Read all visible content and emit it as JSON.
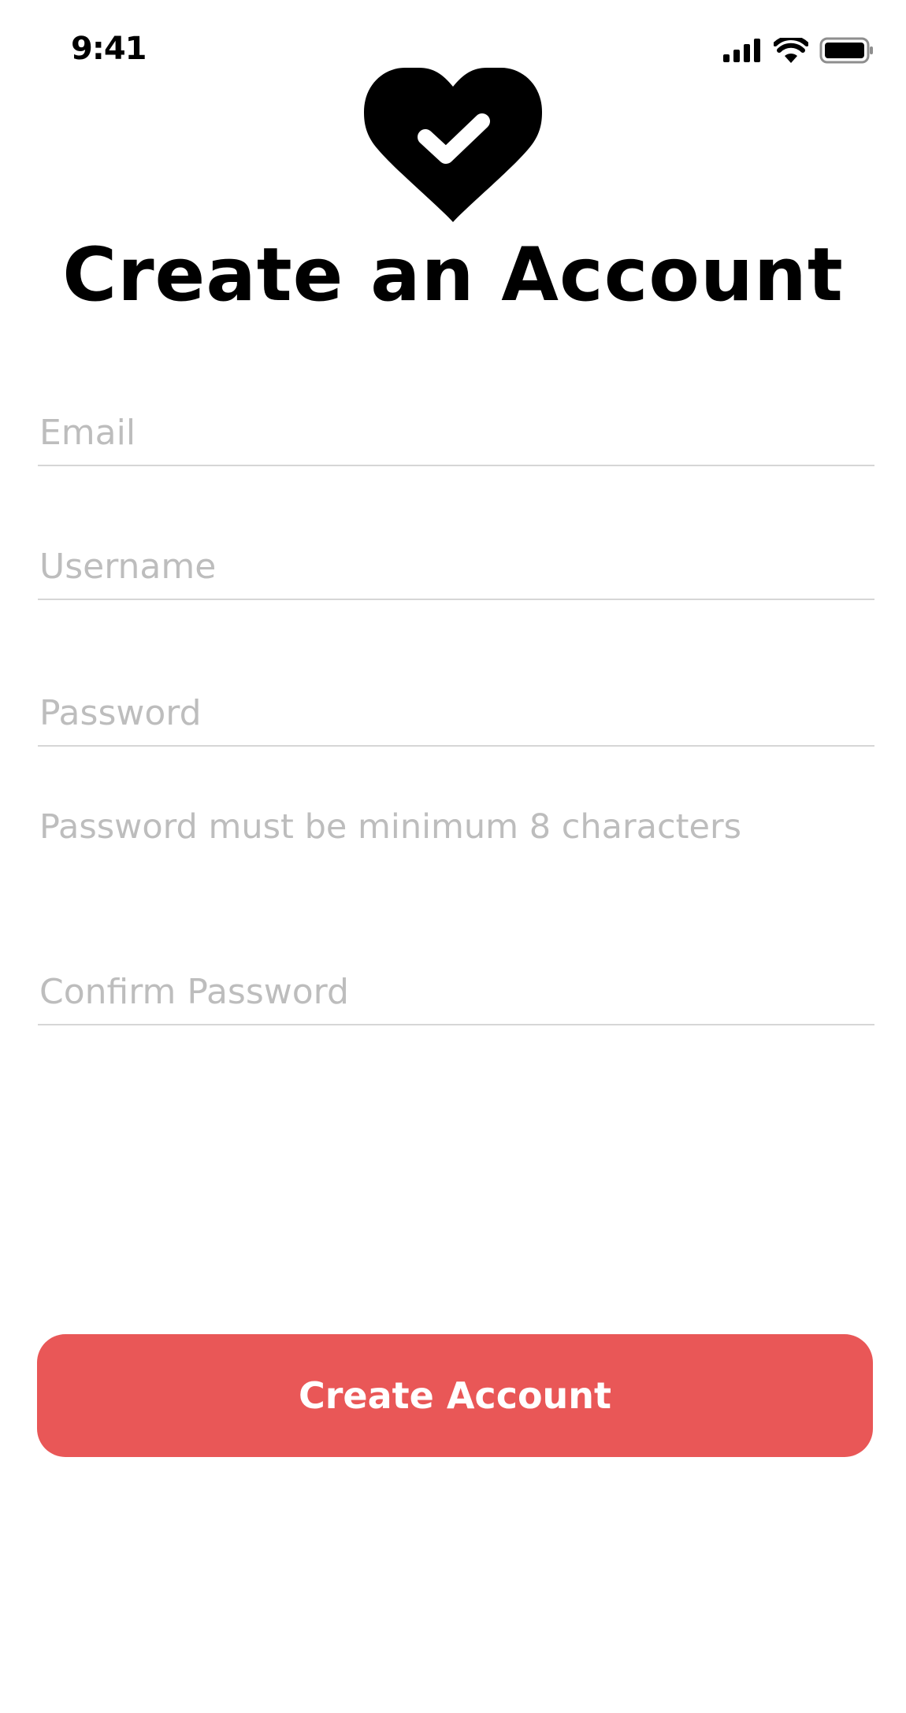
{
  "status_bar": {
    "time": "9:41",
    "icons": [
      "cellular-signal-icon",
      "wifi-icon",
      "battery-icon"
    ]
  },
  "logo": {
    "icon": "heart-check-icon"
  },
  "title": "Create an Account",
  "form": {
    "email_placeholder": "Email",
    "email_value": "",
    "username_placeholder": "Username",
    "username_value": "",
    "password_placeholder": "Password",
    "password_value": "",
    "password_hint": "Password must be minimum 8 characters",
    "confirm_placeholder": "Confirm Password",
    "confirm_value": ""
  },
  "submit_label": "Create Account",
  "colors": {
    "accent": "#e95757",
    "placeholder": "#bdbdbd",
    "divider": "#d6d6d6"
  }
}
